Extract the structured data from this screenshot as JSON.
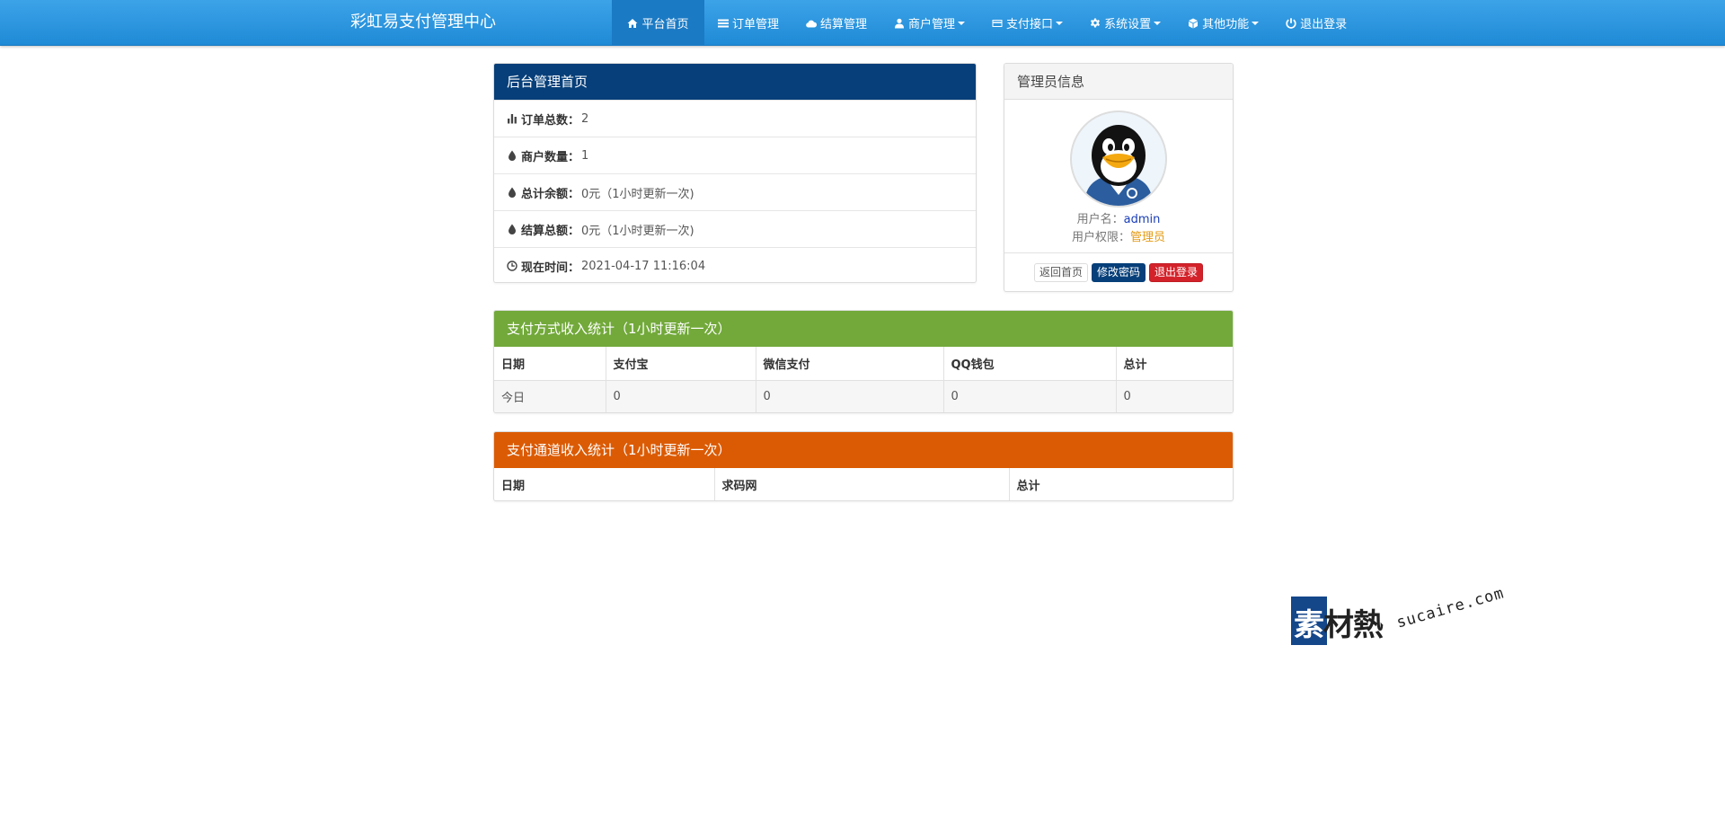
{
  "brand": "彩虹易支付管理中心",
  "nav": [
    {
      "label": "平台首页",
      "icon": "home-icon",
      "dropdown": false,
      "active": true
    },
    {
      "label": "订单管理",
      "icon": "list-icon",
      "dropdown": false,
      "active": false
    },
    {
      "label": "结算管理",
      "icon": "cloud-icon",
      "dropdown": false,
      "active": false
    },
    {
      "label": "商户管理",
      "icon": "user-icon",
      "dropdown": true,
      "active": false
    },
    {
      "label": "支付接口",
      "icon": "credit-card-icon",
      "dropdown": true,
      "active": false
    },
    {
      "label": "系统设置",
      "icon": "gear-icon",
      "dropdown": true,
      "active": false
    },
    {
      "label": "其他功能",
      "icon": "cube-icon",
      "dropdown": true,
      "active": false
    },
    {
      "label": "退出登录",
      "icon": "power-icon",
      "dropdown": false,
      "active": false
    }
  ],
  "dashboard": {
    "title": "后台管理首页",
    "stats": [
      {
        "label": "订单总数：",
        "value": "2",
        "icon": "bar-chart-icon"
      },
      {
        "label": "商户数量：",
        "value": "1",
        "icon": "tint-icon"
      },
      {
        "label": "总计余额：",
        "value": "0元（1小时更新一次)",
        "icon": "tint-icon"
      },
      {
        "label": "结算总额：",
        "value": "0元（1小时更新一次)",
        "icon": "tint-icon"
      },
      {
        "label": "现在时间：",
        "value": " 2021-04-17 11:16:04",
        "icon": "clock-icon"
      }
    ]
  },
  "admin": {
    "title": "管理员信息",
    "avatar_icon": "qq-penguin-avatar",
    "username_label": "用户名：",
    "username": "admin",
    "role_label": "用户权限：",
    "role": "管理员",
    "buttons": {
      "home": "返回首页",
      "change_password": "修改密码",
      "logout": "退出登录"
    }
  },
  "payment_method_stats": {
    "title": "支付方式收入统计（1小时更新一次）",
    "columns": [
      "日期",
      "支付宝",
      "微信支付",
      "QQ钱包",
      "总计"
    ],
    "rows": [
      [
        "今日",
        "0",
        "0",
        "0",
        "0"
      ]
    ]
  },
  "channel_stats": {
    "title": "支付通道收入统计（1小时更新一次）",
    "columns": [
      "日期",
      "求码网",
      "总计"
    ],
    "rows": []
  },
  "watermark": {
    "cn": "素材熱",
    "en": "sucaire.com"
  },
  "colors": {
    "navbar": "#2a96de",
    "navy": "#063f79",
    "green": "#72a93a",
    "orange": "#db5b04",
    "danger": "#d3222a"
  }
}
